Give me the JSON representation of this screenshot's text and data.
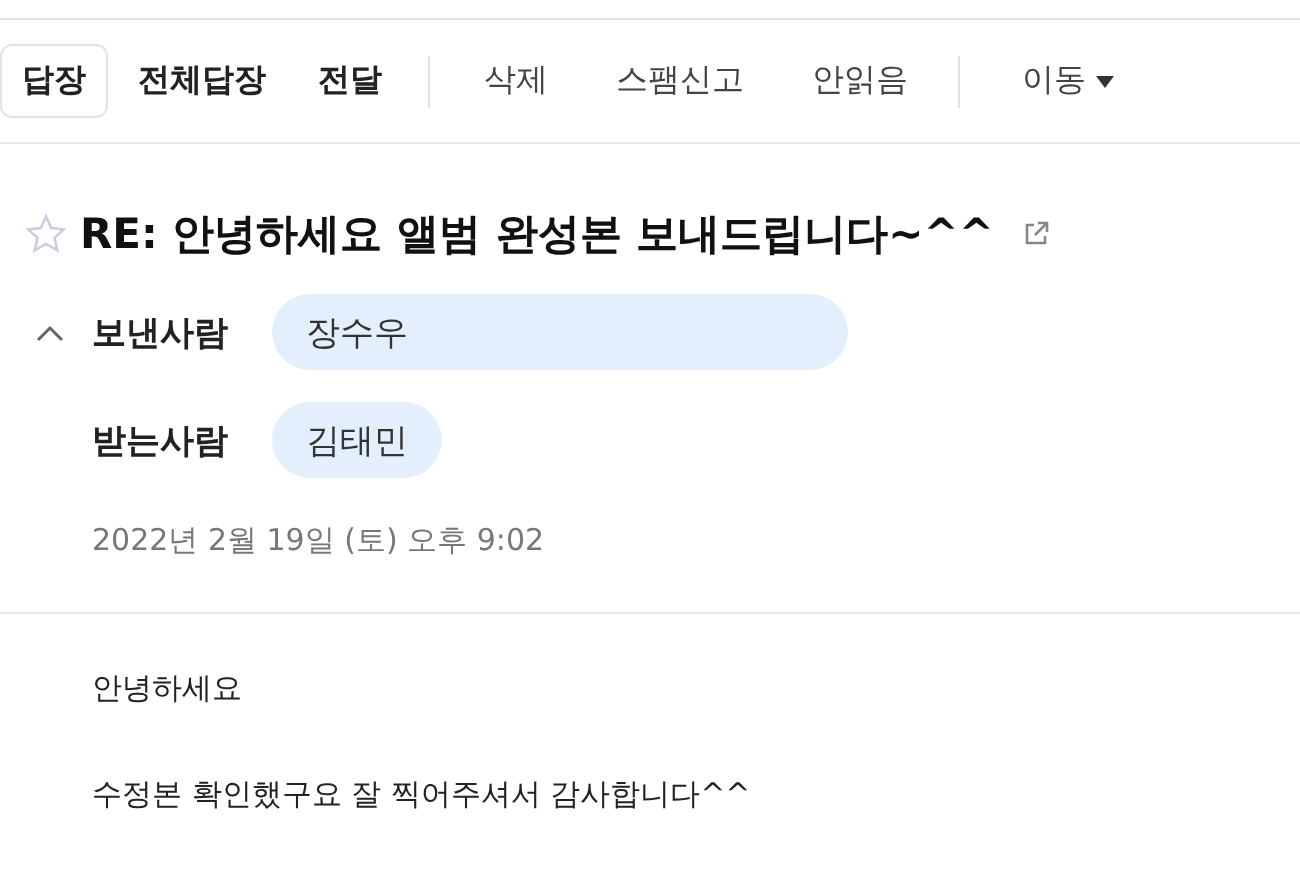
{
  "toolbar": [
    {
      "label": "답장",
      "kind": "primary",
      "selected": true
    },
    {
      "label": "전체답장",
      "kind": "primary",
      "selected": false
    },
    {
      "label": "전달",
      "kind": "primary",
      "selected": false
    },
    {
      "label": "삭제",
      "kind": "secondary",
      "selected": false
    },
    {
      "label": "스팸신고",
      "kind": "secondary",
      "selected": false
    },
    {
      "label": "안읽음",
      "kind": "secondary",
      "selected": false
    },
    {
      "label": "이동",
      "kind": "menu",
      "selected": false
    }
  ],
  "message": {
    "starred": false,
    "subject": "RE: 안녕하세요 앨범 완성본 보내드립니다~^^",
    "header_expanded": true,
    "sender": {
      "label": "보낸사람",
      "name": "장수우"
    },
    "recipient": {
      "label": "받는사람",
      "name": "김태민"
    },
    "date": "2022년 2월 19일 (토) 오후 9:02",
    "body": [
      "안녕하세요",
      "수정본 확인했구요 잘 찍어주셔서 감사합니다^^"
    ]
  }
}
